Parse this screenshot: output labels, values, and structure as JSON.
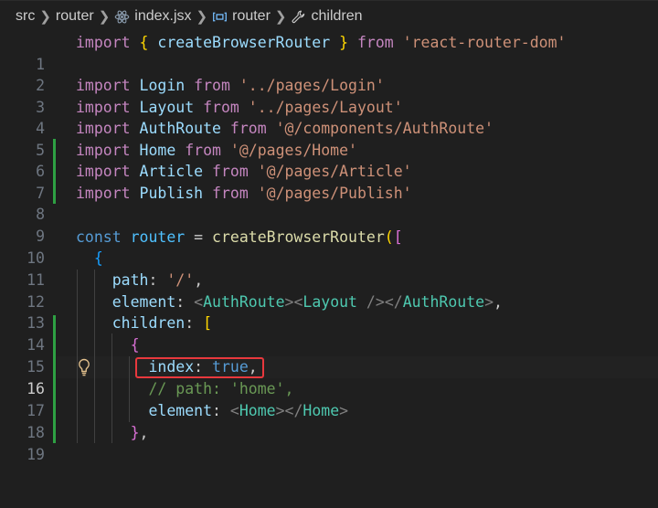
{
  "breadcrumb": {
    "segments": [
      {
        "label": "src",
        "icon": "none"
      },
      {
        "label": "router",
        "icon": "none"
      },
      {
        "label": "index.jsx",
        "icon": "react-icon"
      },
      {
        "label": "router",
        "icon": "variable-icon"
      },
      {
        "label": "children",
        "icon": "wrench-icon"
      }
    ]
  },
  "lines": [
    {
      "n": "1",
      "t": [
        "import",
        " ",
        "{",
        " createBrowserRouter ",
        "}",
        " from ",
        "'react-router-dom'"
      ]
    },
    {
      "n": "2",
      "t": []
    },
    {
      "n": "3",
      "t": [
        "import",
        " Login ",
        "from",
        " ",
        "'../pages/Login'"
      ]
    },
    {
      "n": "4",
      "t": [
        "import",
        " Layout ",
        "from",
        " ",
        "'../pages/Layout'"
      ]
    },
    {
      "n": "5",
      "t": [
        "import",
        " AuthRoute ",
        "from",
        " ",
        "'@/components/AuthRoute'"
      ]
    },
    {
      "n": "6",
      "t": [
        "import",
        " Home ",
        "from",
        " ",
        "'@/pages/Home'"
      ]
    },
    {
      "n": "7",
      "t": [
        "import",
        " Article ",
        "from",
        " ",
        "'@/pages/Article'"
      ]
    },
    {
      "n": "8",
      "t": [
        "import",
        " Publish ",
        "from",
        " ",
        "'@/pages/Publish'"
      ]
    },
    {
      "n": "9",
      "t": []
    },
    {
      "n": "10",
      "t": [
        "const",
        " ",
        "router",
        " = ",
        "createBrowserRouter",
        "(",
        "["
      ]
    },
    {
      "n": "11",
      "t": [
        "  ",
        "{"
      ]
    },
    {
      "n": "12",
      "t": [
        "    ",
        "path",
        ": ",
        "'/'",
        ","
      ]
    },
    {
      "n": "13",
      "t": [
        "    ",
        "element",
        ": ",
        "<",
        "AuthRoute",
        ">",
        "<",
        "Layout",
        " />",
        "</",
        "AuthRoute",
        ">",
        ","
      ]
    },
    {
      "n": "14",
      "t": [
        "    ",
        "children",
        ": ",
        "["
      ]
    },
    {
      "n": "15",
      "t": [
        "      ",
        "{"
      ]
    },
    {
      "n": "16",
      "t": [
        "        ",
        "index",
        ": ",
        "true",
        ","
      ]
    },
    {
      "n": "17",
      "t": [
        "        ",
        "// path: 'home',"
      ]
    },
    {
      "n": "18",
      "t": [
        "        ",
        "element",
        ": ",
        "<",
        "Home",
        ">",
        "</",
        "Home",
        ">"
      ]
    },
    {
      "n": "19",
      "t": [
        "      ",
        "}",
        ","
      ]
    }
  ],
  "active_line": "16",
  "colors": {
    "background": "#1f1f1f",
    "keyword": "#c586c0",
    "function": "#dcdcaa",
    "string": "#ce9178",
    "identifier": "#9cdcfe",
    "constant": "#569cd6",
    "tag": "#4ec9b0",
    "comment": "#6a9955",
    "modified_gutter": "#2ea043",
    "highlight_box": "#e8383d"
  }
}
